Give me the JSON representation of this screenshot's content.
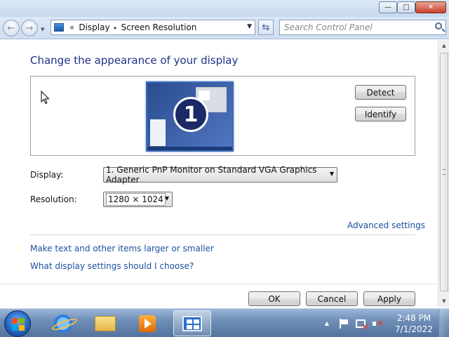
{
  "window": {
    "minimize_label": "—",
    "maximize_label": "□",
    "close_label": "✕"
  },
  "nav": {
    "back_icon": "←",
    "forward_icon": "→",
    "breadcrumb_prefix": "«",
    "breadcrumb_items": [
      "Display",
      "Screen Resolution"
    ],
    "breadcrumb_separator": "▸",
    "refresh_icon": "⇆",
    "search_placeholder": "Search Control Panel"
  },
  "main": {
    "title": "Change the appearance of your display",
    "monitor_number": "1",
    "detect_label": "Detect",
    "identify_label": "Identify",
    "display_label": "Display:",
    "display_value": "1. Generic PnP Monitor on Standard VGA Graphics Adapter",
    "resolution_label": "Resolution:",
    "resolution_value": "1280 × 1024",
    "advanced_settings_link": "Advanced settings",
    "link_text_size": "Make text and other items larger or smaller",
    "link_choose_settings": "What display settings should I choose?",
    "ok_label": "OK",
    "cancel_label": "Cancel",
    "apply_label": "Apply"
  },
  "taskbar": {
    "pinned": [
      "start-button",
      "internet-explorer-icon",
      "windows-explorer-icon",
      "media-player-icon",
      "display-settings-icon"
    ],
    "clock_time": "2:48 PM",
    "clock_date": "7/1/2022"
  }
}
